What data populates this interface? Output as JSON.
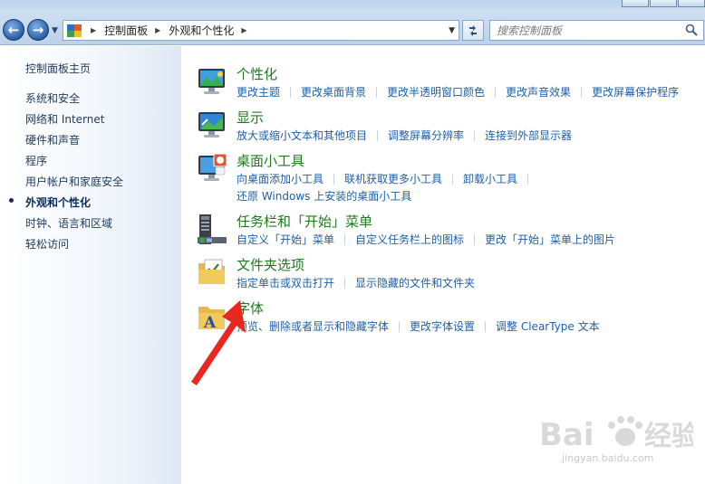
{
  "breadcrumb": {
    "items": [
      "控制面板",
      "外观和个性化"
    ]
  },
  "search": {
    "placeholder": "搜索控制面板"
  },
  "sidebar": {
    "home": "控制面板主页",
    "items": [
      {
        "label": "系统和安全",
        "current": false
      },
      {
        "label": "网络和 Internet",
        "current": false
      },
      {
        "label": "硬件和声音",
        "current": false
      },
      {
        "label": "程序",
        "current": false
      },
      {
        "label": "用户帐户和家庭安全",
        "current": false
      },
      {
        "label": "外观和个性化",
        "current": true
      },
      {
        "label": "时钟、语言和区域",
        "current": false
      },
      {
        "label": "轻松访问",
        "current": false
      }
    ]
  },
  "categories": [
    {
      "title": "个性化",
      "icon": "personalization-icon",
      "links": [
        "更改主题",
        "更改桌面背景",
        "更改半透明窗口颜色",
        "更改声音效果",
        "更改屏幕保护程序"
      ]
    },
    {
      "title": "显示",
      "icon": "display-icon",
      "links": [
        "放大或缩小文本和其他项目",
        "调整屏幕分辨率",
        "连接到外部显示器"
      ]
    },
    {
      "title": "桌面小工具",
      "icon": "gadgets-icon",
      "links": [
        "向桌面添加小工具",
        "联机获取更多小工具",
        "卸载小工具"
      ],
      "links2": [
        "还原 Windows 上安装的桌面小工具"
      ]
    },
    {
      "title": "任务栏和「开始」菜单",
      "icon": "taskbar-icon",
      "links": [
        "自定义「开始」菜单",
        "自定义任务栏上的图标",
        "更改「开始」菜单上的图片"
      ]
    },
    {
      "title": "文件夹选项",
      "icon": "folder-options-icon",
      "links": [
        "指定单击或双击打开",
        "显示隐藏的文件和文件夹"
      ]
    },
    {
      "title": "字体",
      "icon": "fonts-icon",
      "links": [
        "预览、删除或者显示和隐藏字体",
        "更改字体设置",
        "调整 ClearType 文本"
      ]
    }
  ],
  "watermark": {
    "brand": "Bai du 经验",
    "url": "jingyan.baidu.com"
  },
  "colors": {
    "category_title": "#1e7a1e",
    "task_link": "#1e5fa8",
    "arrow": "#e8281e"
  }
}
